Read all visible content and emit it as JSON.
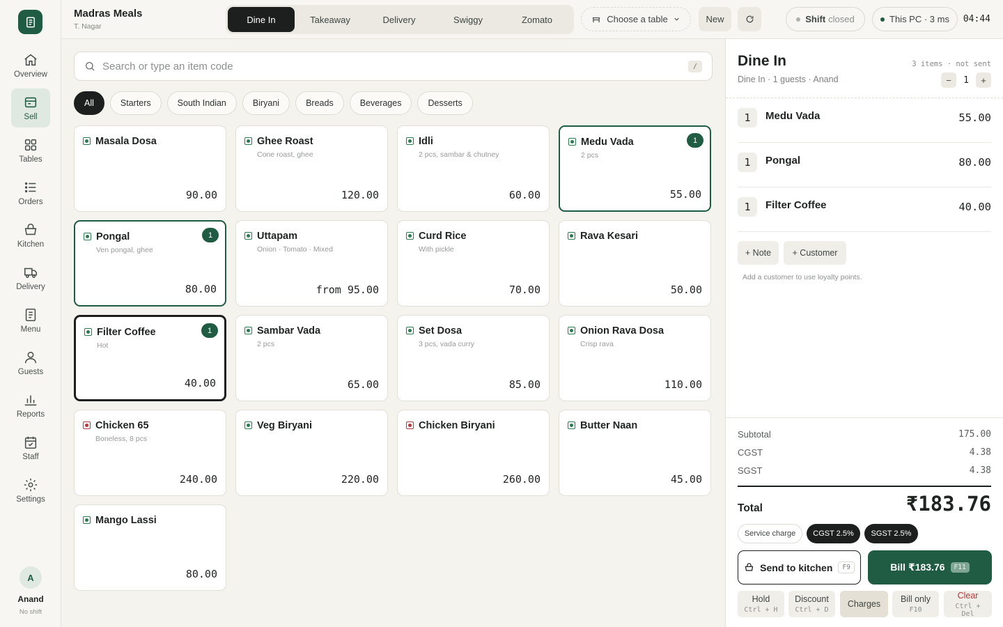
{
  "app": {
    "store_name": "Madras Meals",
    "store_location": "T. Nagar"
  },
  "nav": {
    "items": [
      {
        "label": "Overview",
        "icon": "home-icon"
      },
      {
        "label": "Sell",
        "icon": "register-icon",
        "active": true
      },
      {
        "label": "Tables",
        "icon": "grid-icon"
      },
      {
        "label": "Orders",
        "icon": "list-icon"
      },
      {
        "label": "Kitchen",
        "icon": "basket-icon"
      },
      {
        "label": "Delivery",
        "icon": "truck-icon"
      },
      {
        "label": "Menu",
        "icon": "document-icon"
      },
      {
        "label": "Guests",
        "icon": "person-icon"
      },
      {
        "label": "Reports",
        "icon": "bar-chart-icon"
      },
      {
        "label": "Staff",
        "icon": "calendar-icon"
      },
      {
        "label": "Settings",
        "icon": "gear-icon"
      }
    ],
    "user": {
      "initial": "A",
      "name": "Anand",
      "status": "No shift"
    }
  },
  "topbar": {
    "modes": [
      "Dine In",
      "Takeaway",
      "Delivery",
      "Swiggy",
      "Zomato"
    ],
    "active_mode": "Dine In",
    "table_label": "Choose a table",
    "new_label": "New",
    "shift_label": "Shift",
    "shift_status": "closed",
    "device_label": "This PC · 3 ms",
    "clock": "04:44"
  },
  "search": {
    "placeholder": "Search or type an item code",
    "shortcut": "/"
  },
  "categories": [
    "All",
    "Starters",
    "South Indian",
    "Biryani",
    "Breads",
    "Beverages",
    "Desserts"
  ],
  "active_category": "All",
  "menu_items": [
    {
      "name": "Masala Dosa",
      "sub": "",
      "price": "90.00",
      "veg": true,
      "qty": null
    },
    {
      "name": "Ghee Roast",
      "sub": "Cone roast, ghee",
      "price": "120.00",
      "veg": true,
      "qty": null
    },
    {
      "name": "Idli",
      "sub": "2 pcs, sambar & chutney",
      "price": "60.00",
      "veg": true,
      "qty": null
    },
    {
      "name": "Medu Vada",
      "sub": "2 pcs",
      "price": "55.00",
      "veg": true,
      "qty": "1"
    },
    {
      "name": "Pongal",
      "sub": "Ven pongal, ghee",
      "price": "80.00",
      "veg": true,
      "qty": "1"
    },
    {
      "name": "Uttapam",
      "sub": "Onion · Tomato · Mixed",
      "price": "from 95.00",
      "veg": true,
      "qty": null
    },
    {
      "name": "Curd Rice",
      "sub": "With pickle",
      "price": "70.00",
      "veg": true,
      "qty": null
    },
    {
      "name": "Rava Kesari",
      "sub": "",
      "price": "50.00",
      "veg": true,
      "qty": null
    },
    {
      "name": "Filter Coffee",
      "sub": "Hot",
      "price": "40.00",
      "veg": true,
      "qty": "1",
      "focused": true
    },
    {
      "name": "Sambar Vada",
      "sub": "2 pcs",
      "price": "65.00",
      "veg": true,
      "qty": null
    },
    {
      "name": "Set Dosa",
      "sub": "3 pcs, vada curry",
      "price": "85.00",
      "veg": true,
      "qty": null
    },
    {
      "name": "Onion Rava Dosa",
      "sub": "Crisp rava",
      "price": "110.00",
      "veg": true,
      "qty": null
    },
    {
      "name": "Chicken 65",
      "sub": "Boneless, 8 pcs",
      "price": "240.00",
      "veg": false,
      "qty": null
    },
    {
      "name": "Veg Biryani",
      "sub": "",
      "price": "220.00",
      "veg": true,
      "qty": null
    },
    {
      "name": "Chicken Biryani",
      "sub": "",
      "price": "260.00",
      "veg": false,
      "qty": null
    },
    {
      "name": "Butter Naan",
      "sub": "",
      "price": "45.00",
      "veg": true,
      "qty": null
    },
    {
      "name": "Mango Lassi",
      "sub": "",
      "price": "80.00",
      "veg": true,
      "qty": null
    }
  ],
  "order": {
    "title": "Dine In",
    "subtitle": "Dine In · 1 guests · Anand",
    "meta": "3 items · not sent",
    "guests": "1",
    "lines": [
      {
        "qty": "1",
        "name": "Medu Vada",
        "price": "55.00"
      },
      {
        "qty": "1",
        "name": "Pongal",
        "price": "80.00"
      },
      {
        "qty": "1",
        "name": "Filter Coffee",
        "price": "40.00"
      }
    ],
    "note_label": "+ Note",
    "customer_label": "+ Customer",
    "hint": "Add a customer to use loyalty points.",
    "subtotal_label": "Subtotal",
    "subtotal": "175.00",
    "cgst_label": "CGST",
    "cgst": "4.38",
    "sgst_label": "SGST",
    "sgst": "4.38",
    "total_label": "Total",
    "total": "₹183.76",
    "tax_chips": [
      "Service charge",
      "CGST 2.5%",
      "SGST 2.5%"
    ],
    "send_label": "Send to kitchen",
    "send_kbd": "F9",
    "bill_label": "Bill ₹183.76",
    "bill_kbd": "F11",
    "actions": [
      {
        "label": "Hold",
        "kbd": "Ctrl + H"
      },
      {
        "label": "Discount",
        "kbd": "Ctrl + D"
      },
      {
        "label": "Charges",
        "kbd": ""
      },
      {
        "label": "Bill only",
        "kbd": "F10"
      },
      {
        "label": "Clear",
        "kbd": "Ctrl + Del"
      }
    ]
  },
  "colors": {
    "brand": "#1f5c43",
    "dark": "#1c1f1d",
    "veg": "#2c7a4f",
    "nonveg": "#b23a3a"
  }
}
